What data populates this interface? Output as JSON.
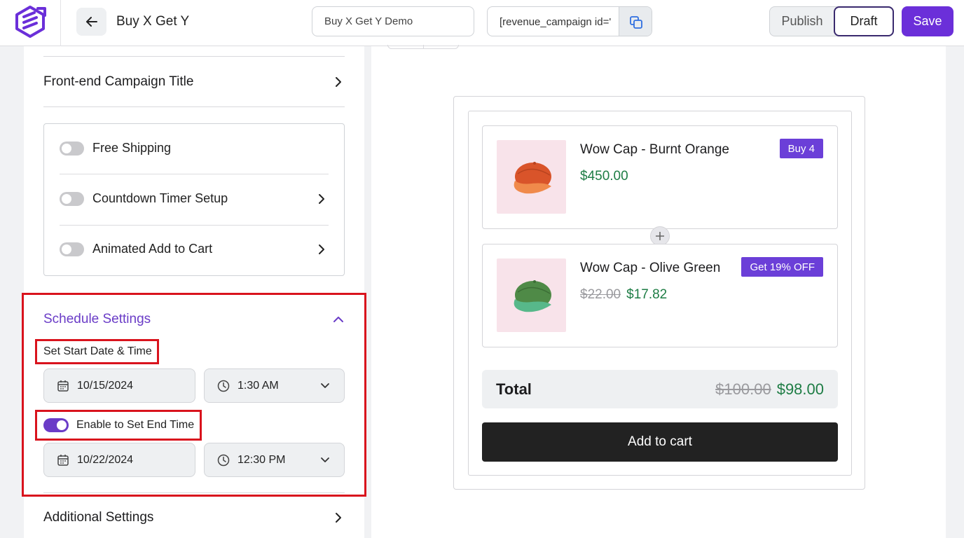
{
  "header": {
    "logo_icon": "brand-logo-icon",
    "back_icon": "arrow-left-icon",
    "title": "Buy X Get Y",
    "campaign_name_value": "Buy X Get Y Demo",
    "shortcode_value": "[revenue_campaign id='",
    "copy_icon": "copy-icon",
    "publish_label": "Publish",
    "draft_label": "Draft",
    "save_label": "Save",
    "accent_color": "#6b2fd9"
  },
  "sidebar": {
    "frontend_title_label": "Front-end Campaign Title",
    "features": [
      {
        "label": "Free Shipping",
        "enabled": false
      },
      {
        "label": "Countdown Timer Setup",
        "enabled": false
      },
      {
        "label": "Animated Add to Cart",
        "enabled": false
      }
    ],
    "schedule": {
      "title": "Schedule Settings",
      "start_label": "Set Start Date & Time",
      "start_date": "10/15/2024",
      "start_time": "1:30 AM",
      "end_toggle_label": "Enable to Set End Time",
      "end_toggle_enabled": true,
      "end_date": "10/22/2024",
      "end_time": "12:30 PM"
    },
    "additional_label": "Additional Settings"
  },
  "preview": {
    "products": [
      {
        "name": "Wow Cap - Burnt Orange",
        "price": "$450.00",
        "old_price": "",
        "badge": "Buy 4",
        "cap_color": "#e2632c"
      },
      {
        "name": "Wow Cap - Olive Green",
        "price": "$17.82",
        "old_price": "$22.00",
        "badge": "Get 19% OFF",
        "cap_color": "#5a8a4a"
      }
    ],
    "total_label": "Total",
    "total_old": "$100.00",
    "total_new": "$98.00",
    "cart_label": "Add to cart",
    "price_color": "#1e7d45"
  }
}
